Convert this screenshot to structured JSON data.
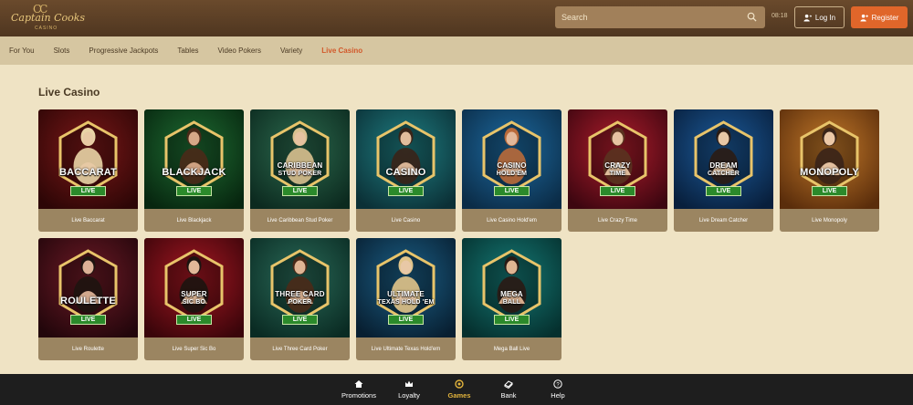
{
  "brand": {
    "name": "Captain Cooks",
    "sub": "CASINO",
    "logo_mark": "CC"
  },
  "header": {
    "search_placeholder": "Search",
    "time": "08:18",
    "login_label": "Log In",
    "register_label": "Register"
  },
  "nav": {
    "items": [
      "For You",
      "Slots",
      "Progressive Jackpots",
      "Tables",
      "Video Pokers",
      "Variety",
      "Live Casino"
    ],
    "active": "Live Casino"
  },
  "section": {
    "title": "Live Casino"
  },
  "games": [
    {
      "label": "Live Baccarat",
      "hex": [
        "BACCARAT"
      ],
      "live": "LIVE",
      "bg": "#7c1818",
      "bg2": "#2d0606",
      "person": "#e8c9a4",
      "hair": "#e9d4a6"
    },
    {
      "label": "Live Blackjack",
      "hex": [
        "BLACKJACK"
      ],
      "live": "LIVE",
      "bg": "#1f6d33",
      "bg2": "#07260f",
      "person": "#d6a887",
      "hair": "#4a2a18"
    },
    {
      "label": "Live Caribbean Stud Poker",
      "hex": [
        "CARIBBEAN",
        "STUD POKER"
      ],
      "live": "LIVE",
      "bg": "#2c6a4e",
      "bg2": "#0c2a1f",
      "person": "#e6c2a0",
      "hair": "#d9c08f"
    },
    {
      "label": "Live Casino",
      "hex": [
        "CASINO"
      ],
      "live": "LIVE",
      "bg": "#1f7f83",
      "bg2": "#0b3036",
      "person": "#e1bc9c",
      "hair": "#3a2418"
    },
    {
      "label": "Live Casino Hold'em",
      "hex": [
        "CASINO",
        "HOLD'EM"
      ],
      "live": "LIVE",
      "bg": "#1d6aa0",
      "bg2": "#0b2c47",
      "person": "#e2b89a",
      "hair": "#b96a3a"
    },
    {
      "label": "Live Crazy Time",
      "hex": [
        "CRAZY",
        "TIME"
      ],
      "live": "LIVE",
      "bg": "#b01d2c",
      "bg2": "#3d0610",
      "person": "#e6c4a2",
      "hair": "#5a3320"
    },
    {
      "label": "Live Dream Catcher",
      "hex": [
        "DREAM",
        "CATCHER"
      ],
      "live": "LIVE",
      "bg": "#1c5b9b",
      "bg2": "#081f3c",
      "person": "#e7c7a5",
      "hair": "#2b1c14"
    },
    {
      "label": "Live Monopoly",
      "hex": [
        "MONOPOLY"
      ],
      "live": "LIVE",
      "bg": "#c47a2a",
      "bg2": "#5a2d0b",
      "person": "#ecc8a6",
      "hair": "#3a2418"
    },
    {
      "label": "Live Roulette",
      "hex": [
        "ROULETTE"
      ],
      "live": "LIVE",
      "bg": "#6e1a26",
      "bg2": "#22060b",
      "person": "#dcb196",
      "hair": "#1e1410"
    },
    {
      "label": "Live Super Sic Bo",
      "hex": [
        "SUPER",
        "SIC BO"
      ],
      "live": "LIVE",
      "bg": "#a51722",
      "bg2": "#3a050a",
      "person": "#e0b898",
      "hair": "#1c1410"
    },
    {
      "label": "Live Three Card Poker",
      "hex": [
        "THREE CARD",
        "POKER"
      ],
      "live": "LIVE",
      "bg": "#2a6a58",
      "bg2": "#0a2b23",
      "person": "#dfb594",
      "hair": "#4a2a18"
    },
    {
      "label": "Live Ultimate Texas Hold'em",
      "hex": [
        "ULTIMATE",
        "TEXAS HOLD 'EM"
      ],
      "live": "LIVE",
      "bg": "#1b5f86",
      "bg2": "#081f31",
      "person": "#e8c8a6",
      "hair": "#e1c48a"
    },
    {
      "label": "Mega Ball Live",
      "hex": [
        "MEGA",
        "BALL"
      ],
      "live": "LIVE",
      "bg": "#157a76",
      "bg2": "#05302e",
      "person": "#dfb592",
      "hair": "#2a1a14"
    }
  ],
  "footer": {
    "items": [
      {
        "label": "Promotions",
        "icon": "home-icon"
      },
      {
        "label": "Loyalty",
        "icon": "crown-icon"
      },
      {
        "label": "Games",
        "icon": "games-icon"
      },
      {
        "label": "Bank",
        "icon": "bank-icon"
      },
      {
        "label": "Help",
        "icon": "help-icon"
      }
    ],
    "active": "Games"
  },
  "colors": {
    "accent": "#e0662a",
    "live_badge": "#2b8a2b",
    "hex_border": "#e8c46a",
    "active_nav": "#d2592b",
    "active_footer": "#e2b33c"
  }
}
